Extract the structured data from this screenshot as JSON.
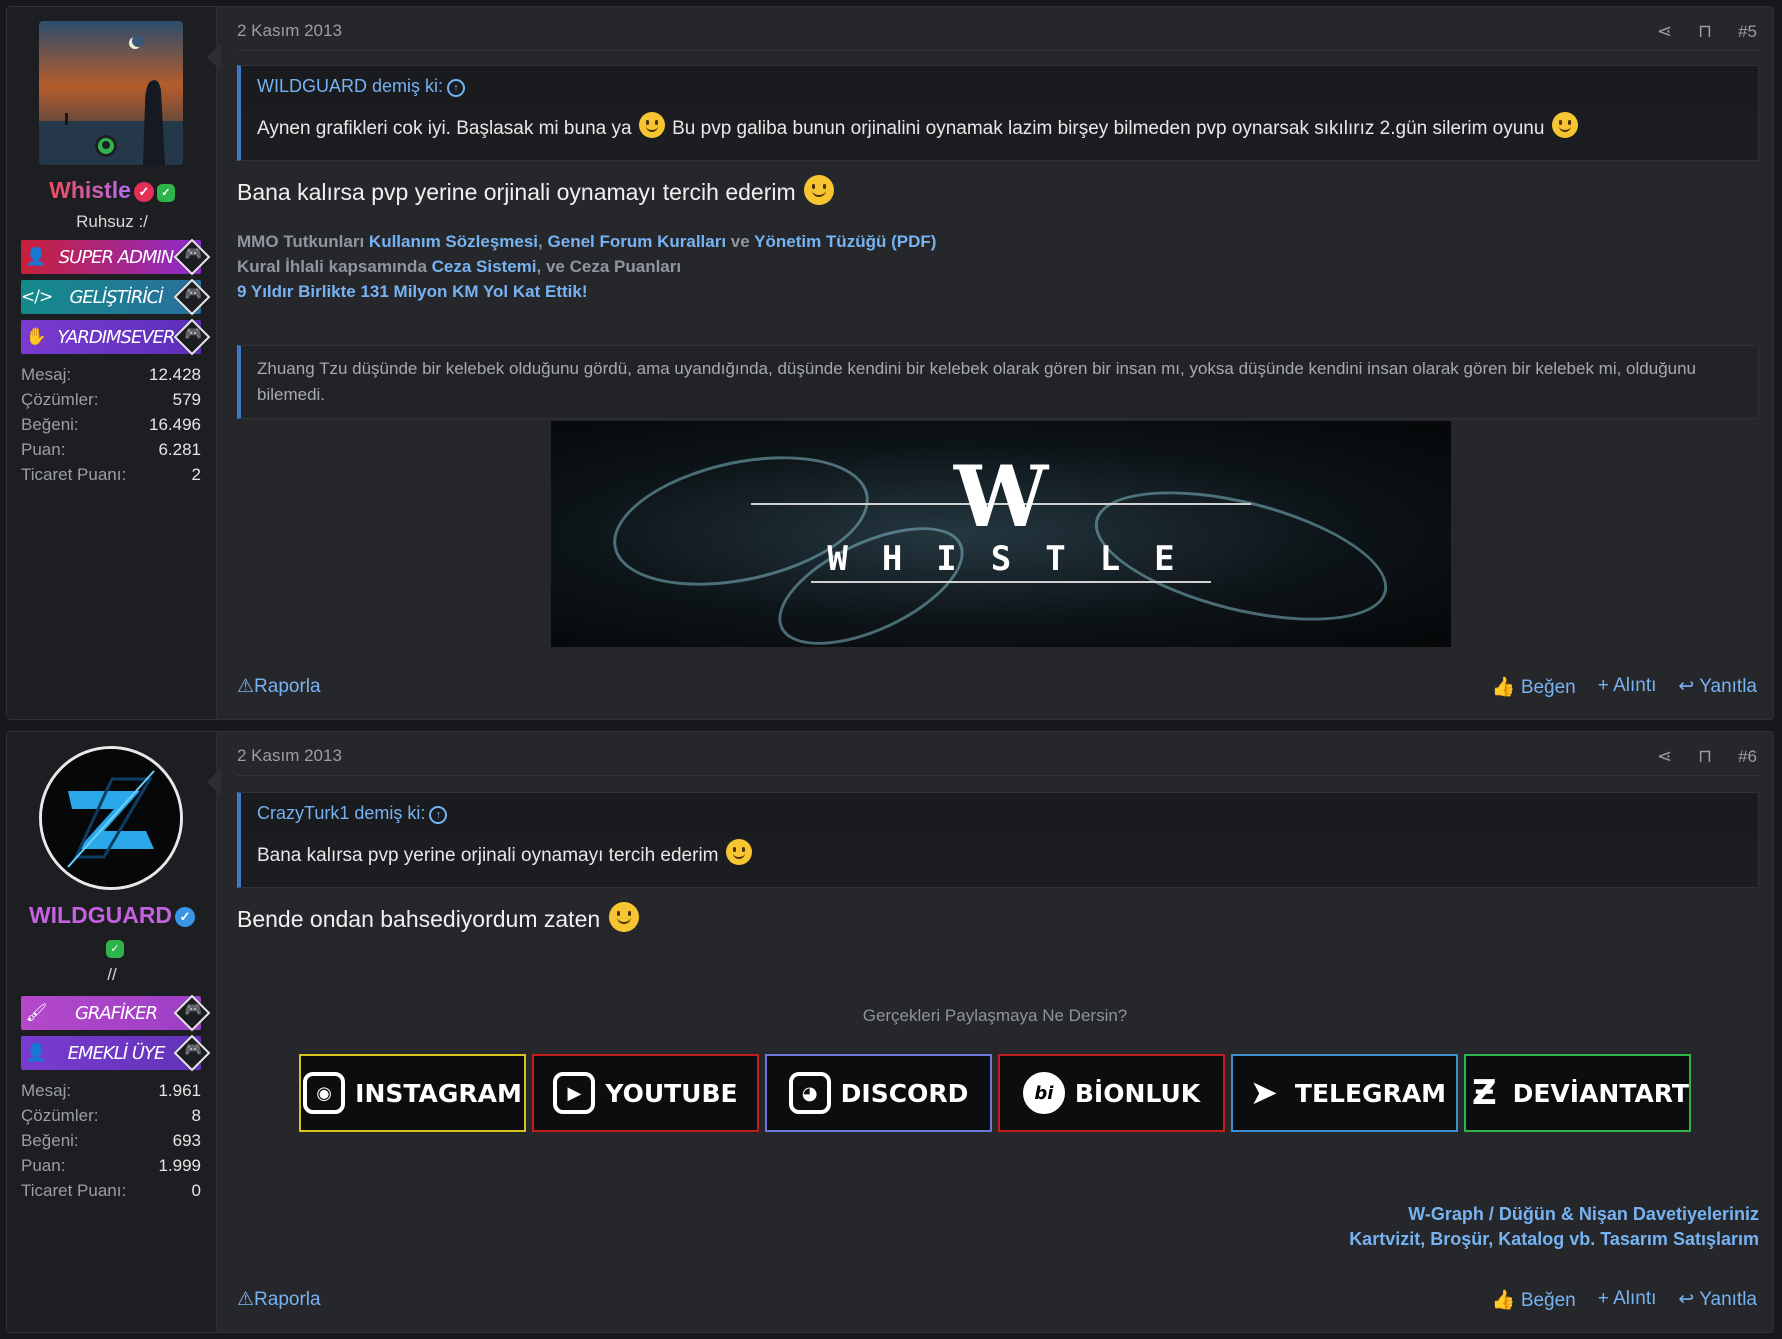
{
  "posts": [
    {
      "user": {
        "name": "Whistle",
        "title": "Ruhsuz :/",
        "banners": [
          "SUPER ADMIN",
          "GELİŞTİRİCİ",
          "YARDIMSEVER"
        ],
        "stats": [
          {
            "k": "Mesaj:",
            "v": "12.428"
          },
          {
            "k": "Çözümler:",
            "v": "579"
          },
          {
            "k": "Beğeni:",
            "v": "16.496"
          },
          {
            "k": "Puan:",
            "v": "6.281"
          },
          {
            "k": "Ticaret Puanı:",
            "v": "2"
          }
        ]
      },
      "date": "2 Kasım 2013",
      "number": "#5",
      "quote": {
        "author": "WILDGUARD demiş ki:",
        "text1": "Aynen grafikleri cok iyi. Başlasak mi buna ya",
        "text2": "Bu pvp galiba bunun orjinalini oynamak lazim birşey bilmeden pvp oynarsak sıkılırız 2.gün silerim oyunu"
      },
      "message": "Bana kalırsa pvp yerine orjinali oynamayı tercih ederim",
      "signature": {
        "line1_prefix": "MMO Tutkunları",
        "line1_link1": "Kullanım Sözleşmesi",
        "line1_sep": ",",
        "line1_link2": "Genel Forum Kuralları",
        "line1_and": "ve",
        "line1_link3": "Yönetim Tüzüğü",
        "line1_pdf": "(PDF)",
        "line2_prefix": "Kural İhlali kapsamında",
        "line2_link": "Ceza Sistemi",
        "line2_suffix": ", ve Ceza Puanları",
        "line3": "9 Yıldır Birlikte 131 Milyon KM Yol Kat Ettik!",
        "quote": "Zhuang Tzu düşünde bir kelebek olduğunu gördü, ama uyandığında, düşünde kendini bir kelebek olarak gören bir insan mı, yoksa düşünde kendini insan olarak gören bir kelebek mi, olduğunu bilemedi.",
        "banner_letter": "W",
        "banner_word": "WHISTLE"
      }
    },
    {
      "user": {
        "name": "WILDGUARD",
        "title": "//",
        "banners": [
          "GRAFİKER",
          "EMEKLİ ÜYE"
        ],
        "stats": [
          {
            "k": "Mesaj:",
            "v": "1.961"
          },
          {
            "k": "Çözümler:",
            "v": "8"
          },
          {
            "k": "Beğeni:",
            "v": "693"
          },
          {
            "k": "Puan:",
            "v": "1.999"
          },
          {
            "k": "Ticaret Puanı:",
            "v": "0"
          }
        ]
      },
      "date": "2 Kasım 2013",
      "number": "#6",
      "quote": {
        "author": "CrazyTurk1 demiş ki:",
        "text": "Bana kalırsa pvp yerine orjinali oynamayı tercih ederim"
      },
      "message": "Bende ondan bahsediyordum zaten",
      "signature": {
        "share_title": "Gerçekleri Paylaşmaya Ne Dersin?",
        "social": [
          {
            "label": "INSTAGRAM",
            "color": "#d9c21c"
          },
          {
            "label": "YOUTUBE",
            "color": "#c41b1b"
          },
          {
            "label": "DISCORD",
            "color": "#6f78d8"
          },
          {
            "label": "BİONLUK",
            "color": "#c41b1b"
          },
          {
            "label": "TELEGRAM",
            "color": "#3e8fd0"
          },
          {
            "label": "DEVİANTART",
            "color": "#2fb34b"
          }
        ],
        "right1": "W-Graph / Düğün & Nişan Davetiyeleriniz",
        "right2": "Kartvizit, Broşür, Katalog vb. Tasarım Satışlarım"
      }
    }
  ],
  "actions": {
    "report": "Raporla",
    "like": "Beğen",
    "quote": "+ Alıntı",
    "reply": "Yanıtla"
  }
}
